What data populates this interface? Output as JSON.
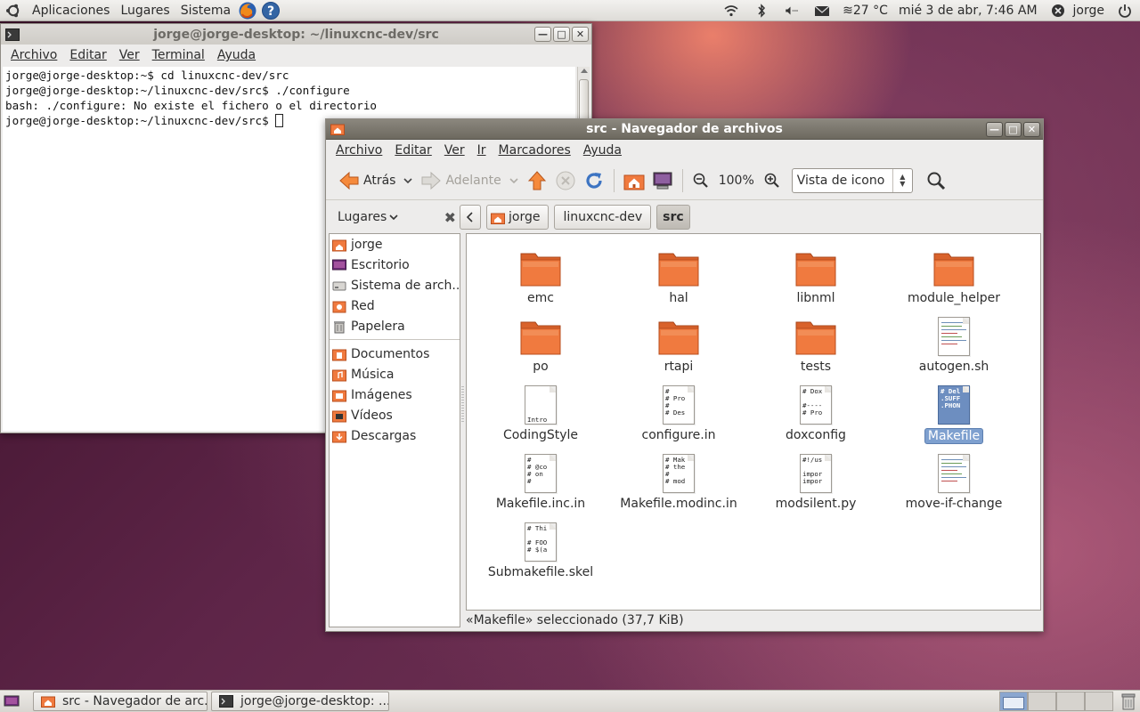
{
  "top_panel": {
    "menus": [
      "Aplicaciones",
      "Lugares",
      "Sistema"
    ],
    "weather": "≋27 °C",
    "clock": "mié  3 de abr,  7:46 AM",
    "user": "jorge"
  },
  "terminal": {
    "title": "jorge@jorge-desktop: ~/linuxcnc-dev/src",
    "menu": [
      "Archivo",
      "Editar",
      "Ver",
      "Terminal",
      "Ayuda"
    ],
    "lines": [
      "jorge@jorge-desktop:~$ cd linuxcnc-dev/src",
      "jorge@jorge-desktop:~/linuxcnc-dev/src$ ./configure",
      "bash: ./configure: No existe el fichero o el directorio",
      "jorge@jorge-desktop:~/linuxcnc-dev/src$ "
    ]
  },
  "nautilus": {
    "title": "src - Navegador de archivos",
    "menu": [
      "Archivo",
      "Editar",
      "Ver",
      "Ir",
      "Marcadores",
      "Ayuda"
    ],
    "toolbar": {
      "back": "Atrás",
      "forward": "Adelante",
      "zoom": "100%",
      "view_mode": "Vista de icono"
    },
    "places_label": "Lugares",
    "breadcrumbs": [
      "jorge",
      "linuxcnc-dev",
      "src"
    ],
    "sidebar": [
      {
        "label": "jorge",
        "icon": "home-folder-icon"
      },
      {
        "label": "Escritorio",
        "icon": "desktop-icon"
      },
      {
        "label": "Sistema de arch...",
        "icon": "drive-icon"
      },
      {
        "label": "Red",
        "icon": "network-icon"
      },
      {
        "label": "Papelera",
        "icon": "trash-icon"
      }
    ],
    "sidebar_bookmarks": [
      {
        "label": "Documentos",
        "icon": "documents-folder-icon"
      },
      {
        "label": "Música",
        "icon": "music-folder-icon"
      },
      {
        "label": "Imágenes",
        "icon": "pictures-folder-icon"
      },
      {
        "label": "Vídeos",
        "icon": "videos-folder-icon"
      },
      {
        "label": "Descargas",
        "icon": "downloads-folder-icon"
      }
    ],
    "files": [
      {
        "name": "emc",
        "kind": "folder"
      },
      {
        "name": "hal",
        "kind": "folder"
      },
      {
        "name": "libnml",
        "kind": "folder"
      },
      {
        "name": "module_helper",
        "kind": "folder"
      },
      {
        "name": "po",
        "kind": "folder"
      },
      {
        "name": "rtapi",
        "kind": "folder"
      },
      {
        "name": "tests",
        "kind": "folder"
      },
      {
        "name": "autogen.sh",
        "kind": "script"
      },
      {
        "name": "CodingStyle",
        "kind": "text",
        "preview": "\n\n\n\nIntro"
      },
      {
        "name": "configure.in",
        "kind": "text",
        "preview": "#\n# Pro\n#\n# Des"
      },
      {
        "name": "doxconfig",
        "kind": "text",
        "preview": "# Dox\n\n#----\n# Pro"
      },
      {
        "name": "Makefile",
        "kind": "text",
        "preview": "# Del\n.SUFF\n.PHON",
        "selected": true
      },
      {
        "name": "Makefile.inc.in",
        "kind": "text",
        "preview": "#\n# @co\n# on\n#"
      },
      {
        "name": "Makefile.modinc.in",
        "kind": "text",
        "preview": "# Mak\n# the\n#\n# mod"
      },
      {
        "name": "modsilent.py",
        "kind": "text",
        "preview": "#!/us\n\nimpor\nimpor"
      },
      {
        "name": "move-if-change",
        "kind": "script"
      },
      {
        "name": "Submakefile.skel",
        "kind": "text",
        "preview": "# Thi\n\n# FOO\n# $(a"
      }
    ],
    "status": "«Makefile» seleccionado (37,7 KiB)"
  },
  "taskbar": {
    "tasks": [
      "src - Navegador de arc...",
      "jorge@jorge-desktop: ..."
    ]
  },
  "colors": {
    "folder": "#f07a3f",
    "selection": "#7ea0cf",
    "titlebar_active": "#7a766d"
  }
}
